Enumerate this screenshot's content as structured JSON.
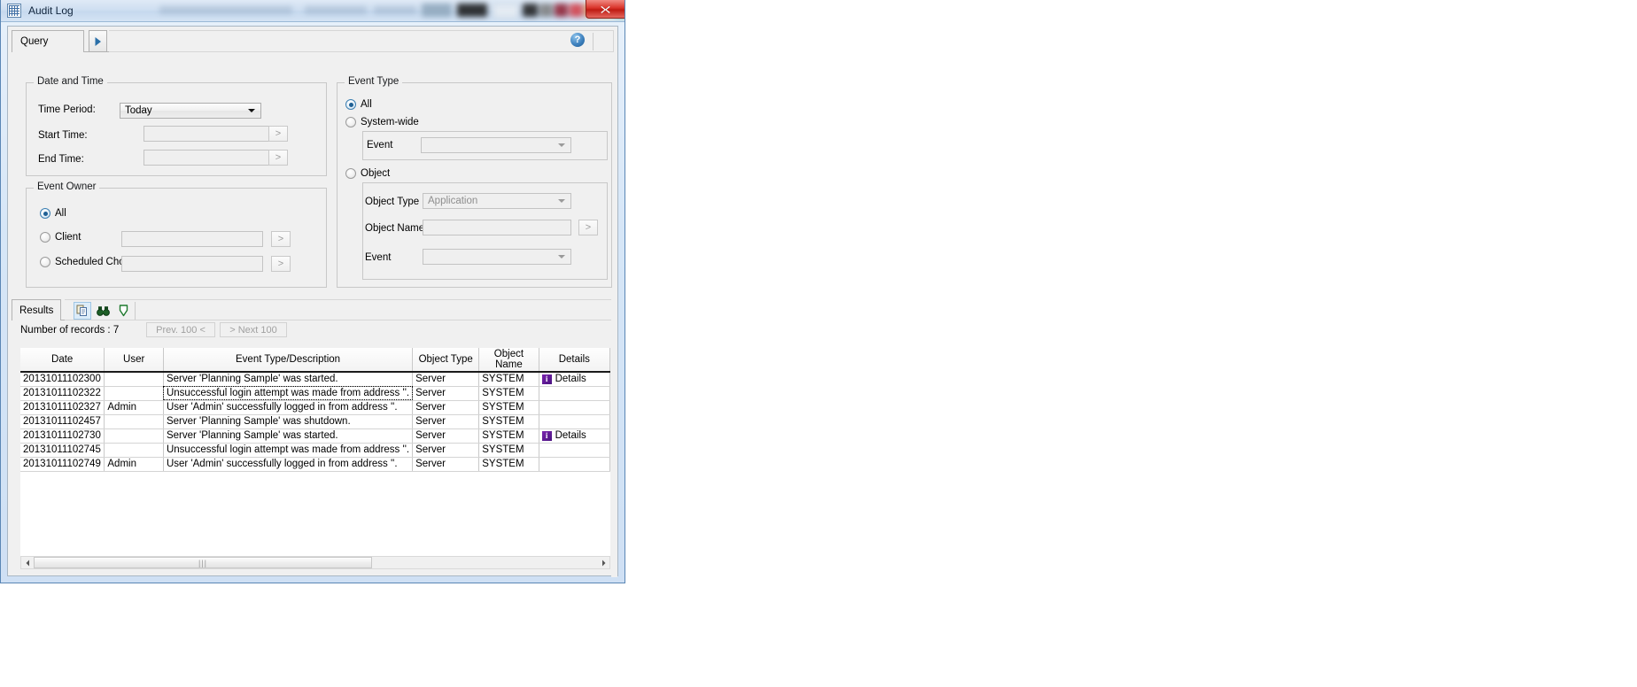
{
  "window": {
    "title": "Audit Log",
    "icon": "grid-app-icon",
    "close_label": "close-icon"
  },
  "query_tab": {
    "label": "Query",
    "run_icon": "play-arrow-icon",
    "help_icon": "help-icon",
    "help_label": "?"
  },
  "date_and_time": {
    "title": "Date and Time",
    "time_period_label": "Time Period:",
    "time_period_value": "Today",
    "start_time_label": "Start Time:",
    "start_time_value": "",
    "end_time_label": "End Time:",
    "end_time_value": "",
    "browse_label": ">"
  },
  "event_owner": {
    "title": "Event Owner",
    "options": [
      {
        "label": "All",
        "checked": true
      },
      {
        "label": "Client",
        "checked": false
      },
      {
        "label": "Scheduled Chore",
        "checked": false
      }
    ],
    "client_value": "",
    "scheduled_chore_value": "",
    "browse_label": ">"
  },
  "event_type": {
    "title": "Event Type",
    "options": [
      {
        "label": "All",
        "checked": true
      },
      {
        "label": "System-wide",
        "checked": false
      },
      {
        "label": "Object",
        "checked": false
      }
    ],
    "system_event_label": "Event",
    "system_event_value": "",
    "object_type_label": "Object Type",
    "object_type_value": "Application",
    "object_name_label": "Object Name",
    "object_name_value": "",
    "object_event_label": "Event",
    "object_event_value": "",
    "browse_label": ">"
  },
  "results": {
    "tab_label": "Results",
    "toolbar": [
      {
        "name": "copy-icon",
        "title": "Copy"
      },
      {
        "name": "find-icon",
        "title": "Find"
      },
      {
        "name": "export-icon",
        "title": "Export"
      }
    ],
    "records_text": "Number of records : 7",
    "prev_label": "Prev. 100 <",
    "next_label": "> Next 100",
    "columns": [
      "Date",
      "User",
      "Event Type/Description",
      "Object Type",
      "Object Name",
      "Details"
    ],
    "rows": [
      {
        "date": "20131011102300",
        "user": "",
        "description": "Server 'Planning Sample' was started.",
        "object_type": "Server",
        "object_name": "SYSTEM",
        "details": "Details",
        "has_details": true,
        "focused": false
      },
      {
        "date": "20131011102322",
        "user": "",
        "description": "Unsuccessful login attempt was made from address ''.",
        "object_type": "Server",
        "object_name": "SYSTEM",
        "details": "",
        "has_details": false,
        "focused": true
      },
      {
        "date": "20131011102327",
        "user": "Admin",
        "description": "User 'Admin' successfully logged in from address ''.",
        "object_type": "Server",
        "object_name": "SYSTEM",
        "details": "",
        "has_details": false,
        "focused": false
      },
      {
        "date": "20131011102457",
        "user": "",
        "description": "Server 'Planning Sample' was shutdown.",
        "object_type": "Server",
        "object_name": "SYSTEM",
        "details": "",
        "has_details": false,
        "focused": false
      },
      {
        "date": "20131011102730",
        "user": "",
        "description": "Server 'Planning Sample' was started.",
        "object_type": "Server",
        "object_name": "SYSTEM",
        "details": "Details",
        "has_details": true,
        "focused": false
      },
      {
        "date": "20131011102745",
        "user": "",
        "description": "Unsuccessful login attempt was made from address ''.",
        "object_type": "Server",
        "object_name": "SYSTEM",
        "details": "",
        "has_details": false,
        "focused": false
      },
      {
        "date": "20131011102749",
        "user": "Admin",
        "description": "User 'Admin' successfully logged in from address ''.",
        "object_type": "Server",
        "object_name": "SYSTEM",
        "details": "",
        "has_details": false,
        "focused": false
      }
    ],
    "scrollbar": {
      "left_arrow": "chevron-left-icon",
      "right_arrow": "chevron-right-icon",
      "grip": "|||"
    }
  },
  "colors": {
    "titlebar_start": "#dfeaf6",
    "titlebar_end": "#d4e3f4",
    "close_red": "#d9342a",
    "accent_blue": "#1f6094",
    "details_purple": "#5a1a93",
    "export_green": "#1e7a2e",
    "client_bg": "#f0f0f0"
  }
}
